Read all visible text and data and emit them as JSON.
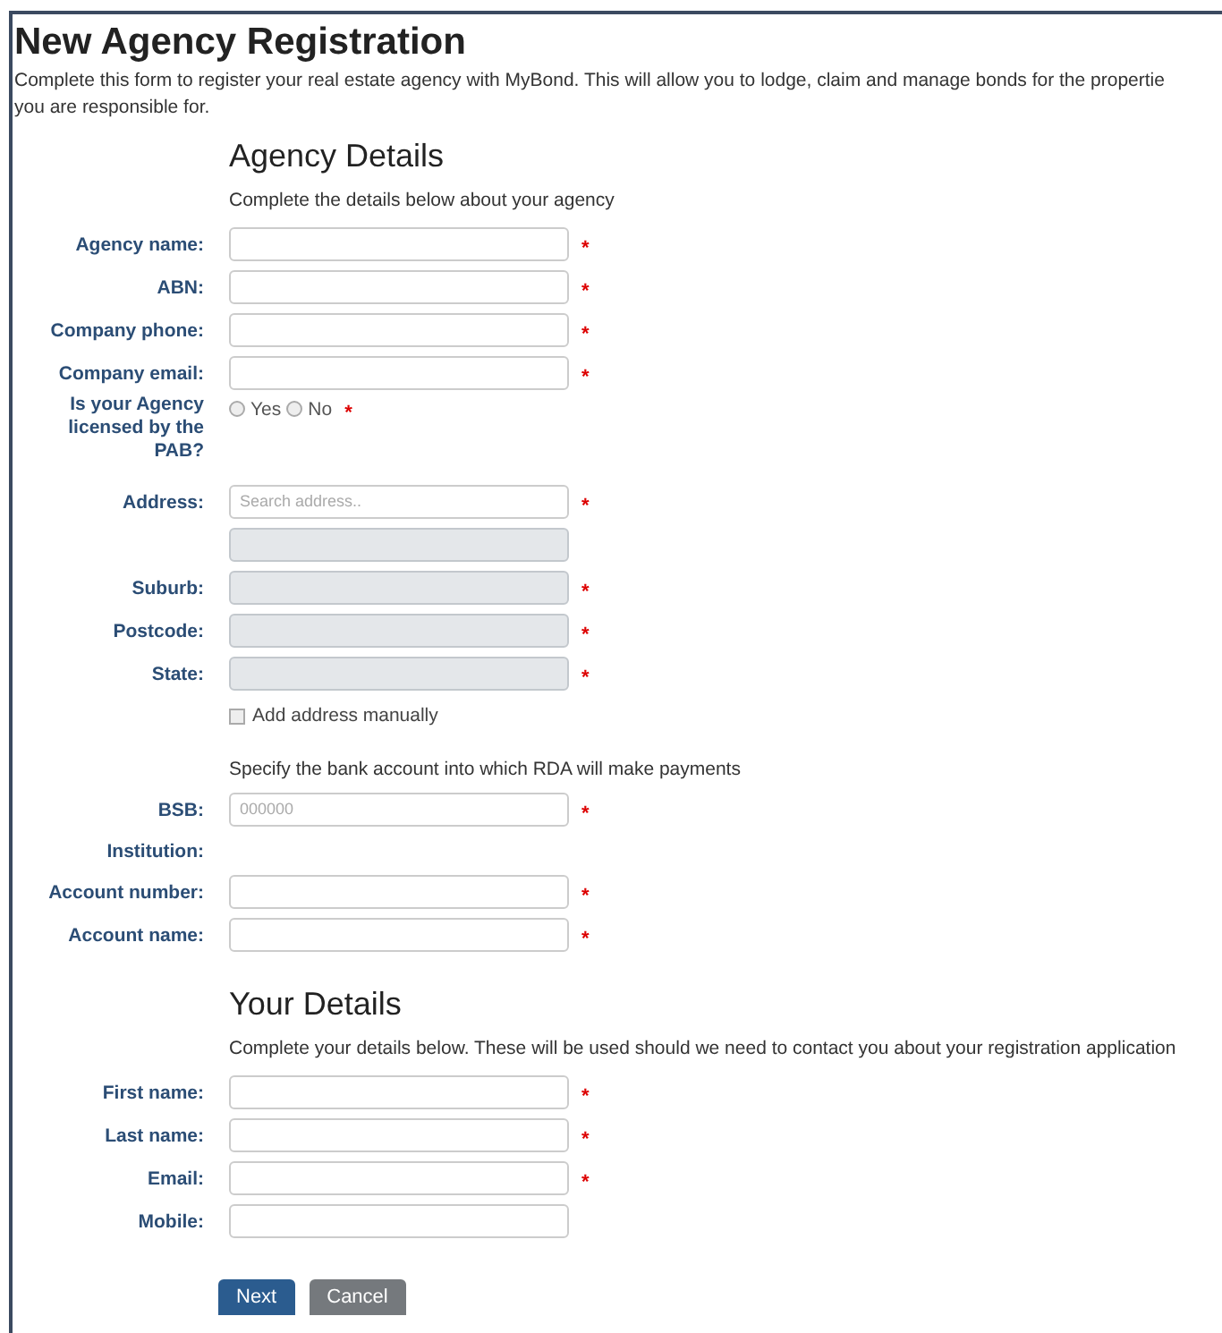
{
  "title": "New Agency Registration",
  "intro_lines": [
    "Complete this form to register your real estate agency with MyBond. This will allow you to lodge, claim and manage bonds for the propertie",
    "you are responsible for."
  ],
  "sections": [
    {
      "heading": "Agency Details",
      "note": "Complete the details below about your agency",
      "fields": [
        {
          "kind": "text",
          "label": "Agency name:",
          "disabled": false,
          "marker": "*"
        },
        {
          "kind": "text",
          "label": "ABN:",
          "disabled": false,
          "marker": "*"
        },
        {
          "kind": "text",
          "label": "Company phone:",
          "disabled": false,
          "marker": "*"
        },
        {
          "kind": "text",
          "label": "Company email:",
          "disabled": false,
          "marker": "*"
        },
        {
          "kind": "radio",
          "label": "Is your Agency licensed by the PAB?",
          "options": [
            {
              "label": "Yes",
              "selected": false
            },
            {
              "label": "No",
              "selected": false
            }
          ],
          "marker": "*"
        },
        {
          "kind": "text",
          "label": "Address:",
          "placeholder": "Search address..",
          "disabled": false,
          "marker": "*"
        },
        {
          "kind": "text",
          "disabled": true
        },
        {
          "kind": "text",
          "label": "Suburb:",
          "disabled": true,
          "marker": "*"
        },
        {
          "kind": "text",
          "label": "Postcode:",
          "disabled": true,
          "marker": "*"
        },
        {
          "kind": "text",
          "label": "State:",
          "disabled": true,
          "marker": "*"
        },
        {
          "kind": "checkbox",
          "label": "Add address manually",
          "checked": false
        },
        {
          "kind": "note",
          "text": "Specify the bank account into which RDA will make payments"
        },
        {
          "kind": "text",
          "label": "BSB:",
          "placeholder": "000000",
          "disabled": false,
          "marker": "*"
        },
        {
          "kind": "static",
          "label": "Institution:"
        },
        {
          "kind": "text",
          "label": "Account number:",
          "disabled": false,
          "marker": "*"
        },
        {
          "kind": "text",
          "label": "Account name:",
          "disabled": false,
          "marker": "*"
        }
      ]
    },
    {
      "heading": "Your Details",
      "note": "Complete your details below. These will be used should we need to contact you about your registration application",
      "fields": [
        {
          "kind": "text",
          "label": "First name:",
          "disabled": false,
          "marker": "*"
        },
        {
          "kind": "text",
          "label": "Last name:",
          "disabled": false,
          "marker": "*"
        },
        {
          "kind": "text",
          "label": "Email:",
          "disabled": false,
          "marker": "*"
        },
        {
          "kind": "text",
          "label": "Mobile:",
          "disabled": false
        }
      ]
    }
  ],
  "buttons": [
    {
      "label": "Next",
      "kind": "primary"
    },
    {
      "label": "Cancel",
      "kind": "secondary"
    }
  ]
}
